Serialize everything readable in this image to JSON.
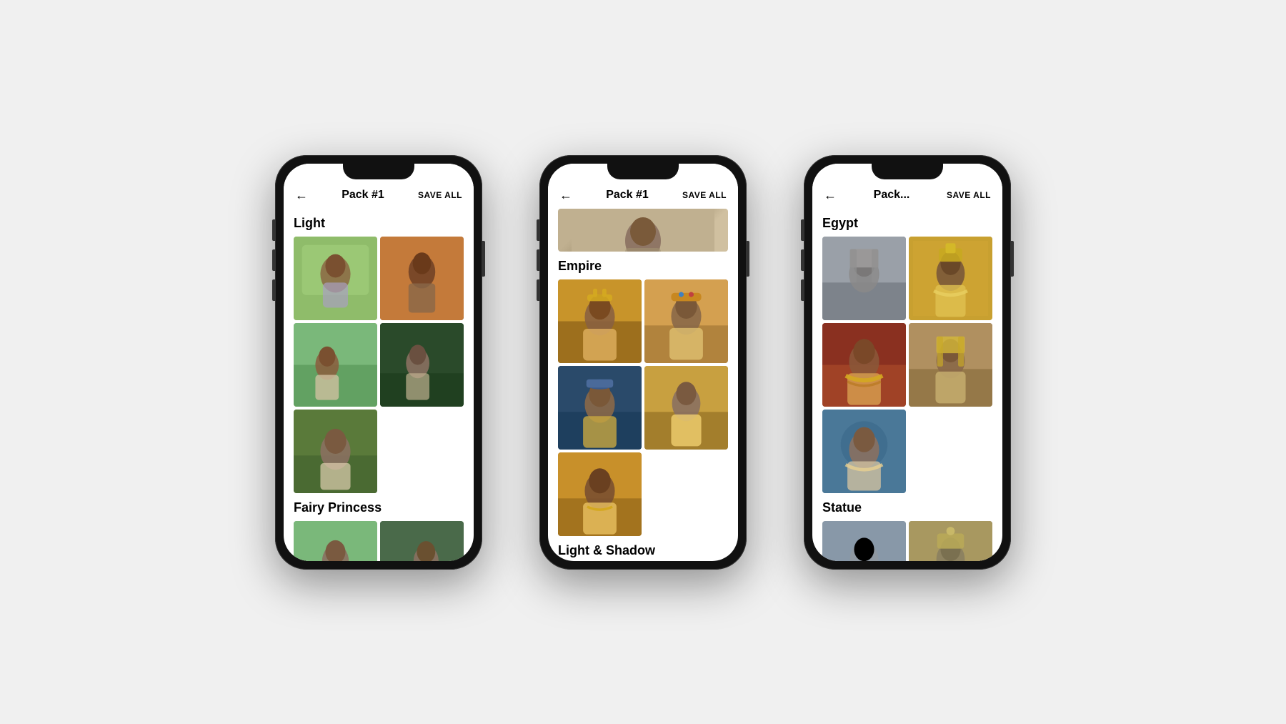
{
  "phones": [
    {
      "id": "phone-1",
      "header": {
        "back_label": "←",
        "title": "Pack #1",
        "action_label": "SAVE ALL"
      },
      "sections": [
        {
          "id": "light",
          "title": "Light",
          "images": [
            {
              "id": "l1",
              "style": "img-light-1"
            },
            {
              "id": "l2",
              "style": "img-light-2"
            },
            {
              "id": "l3",
              "style": "img-light-3"
            },
            {
              "id": "l4",
              "style": "img-light-4"
            },
            {
              "id": "l5",
              "style": "img-light-5"
            }
          ]
        },
        {
          "id": "fairy-princess",
          "title": "Fairy Princess",
          "images": [
            {
              "id": "f1",
              "style": "img-fairy-1"
            },
            {
              "id": "f2",
              "style": "img-fairy-2"
            }
          ]
        }
      ]
    },
    {
      "id": "phone-2",
      "header": {
        "back_label": "←",
        "title": "Pack #1",
        "action_label": "SAVE ALL"
      },
      "sections": [
        {
          "id": "empire-top",
          "title": "",
          "images": [
            {
              "id": "et1",
              "style": "img-empire-top",
              "wide": true
            }
          ]
        },
        {
          "id": "empire",
          "title": "Empire",
          "images": [
            {
              "id": "e1",
              "style": "img-empire-1"
            },
            {
              "id": "e2",
              "style": "img-empire-2"
            },
            {
              "id": "e3",
              "style": "img-empire-3"
            },
            {
              "id": "e4",
              "style": "img-empire-4"
            },
            {
              "id": "e5",
              "style": "img-empire-5"
            }
          ]
        },
        {
          "id": "light-shadow",
          "title": "Light & Shadow",
          "images": []
        }
      ]
    },
    {
      "id": "phone-3",
      "header": {
        "back_label": "←",
        "title": "Pack...",
        "action_label": "SAVE ALL"
      },
      "sections": [
        {
          "id": "egypt",
          "title": "Egypt",
          "images": [
            {
              "id": "eg1",
              "style": "img-egypt-1"
            },
            {
              "id": "eg2",
              "style": "img-egypt-2"
            },
            {
              "id": "eg3",
              "style": "img-egypt-3"
            },
            {
              "id": "eg4",
              "style": "img-egypt-4"
            },
            {
              "id": "eg5",
              "style": "img-egypt-5"
            }
          ]
        },
        {
          "id": "statue",
          "title": "Statue",
          "images": [
            {
              "id": "s1",
              "style": "img-statue-1"
            },
            {
              "id": "s2",
              "style": "img-statue-2"
            }
          ]
        }
      ]
    }
  ]
}
